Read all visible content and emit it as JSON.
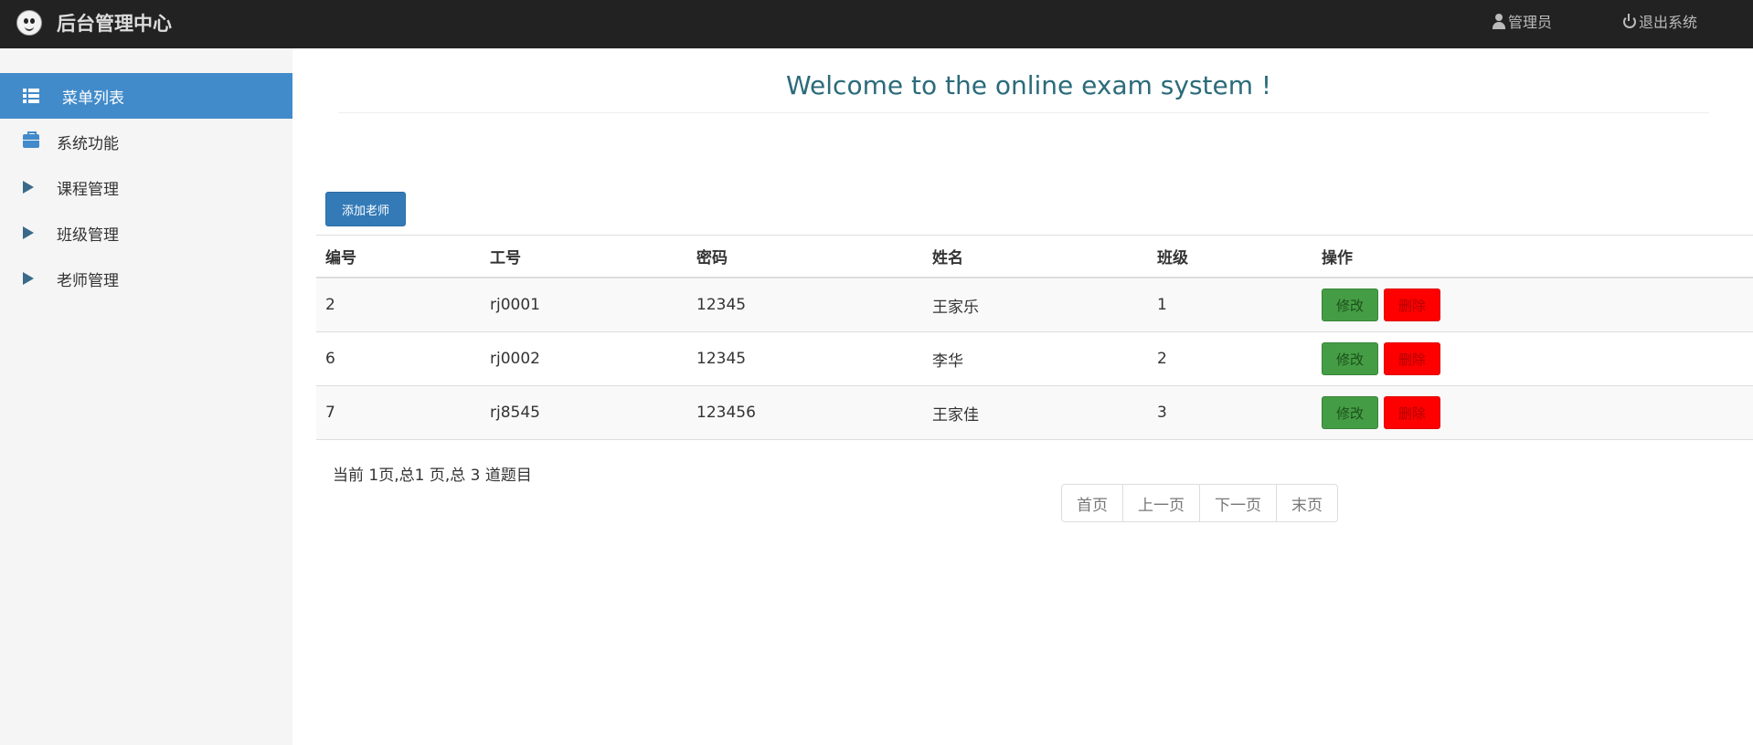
{
  "header": {
    "title": "后台管理中心",
    "user_label": "管理员",
    "logout_label": "退出系统"
  },
  "sidebar": {
    "items": [
      {
        "label": "菜单列表",
        "icon": "list-icon"
      },
      {
        "label": "系统功能",
        "icon": "briefcase-icon"
      },
      {
        "label": "课程管理",
        "icon": "triangle-right-icon"
      },
      {
        "label": "班级管理",
        "icon": "triangle-right-icon"
      },
      {
        "label": "老师管理",
        "icon": "triangle-right-icon"
      }
    ]
  },
  "main": {
    "welcome": "Welcome to the online exam system !",
    "add_button": "添加老师",
    "table": {
      "headers": [
        "编号",
        "工号",
        "密码",
        "姓名",
        "班级",
        "操作"
      ],
      "rows": [
        {
          "id": "2",
          "work_no": "rj0001",
          "password": "12345",
          "name": "王家乐",
          "class": "1",
          "edit": "修改",
          "delete": "删除"
        },
        {
          "id": "6",
          "work_no": "rj0002",
          "password": "12345",
          "name": "李华",
          "class": "2",
          "edit": "修改",
          "delete": "删除"
        },
        {
          "id": "7",
          "work_no": "rj8545",
          "password": "123456",
          "name": "王家佳",
          "class": "3",
          "edit": "修改",
          "delete": "删除"
        }
      ]
    },
    "page_info": "当前 1页,总1 页,总 3 道题目",
    "pager": {
      "first": "首页",
      "prev": "上一页",
      "next": "下一页",
      "last": "末页"
    }
  },
  "colors": {
    "topbar": "#222222",
    "accent": "#428bca",
    "edit_button": "#449d44",
    "delete_button": "#ff0000"
  }
}
